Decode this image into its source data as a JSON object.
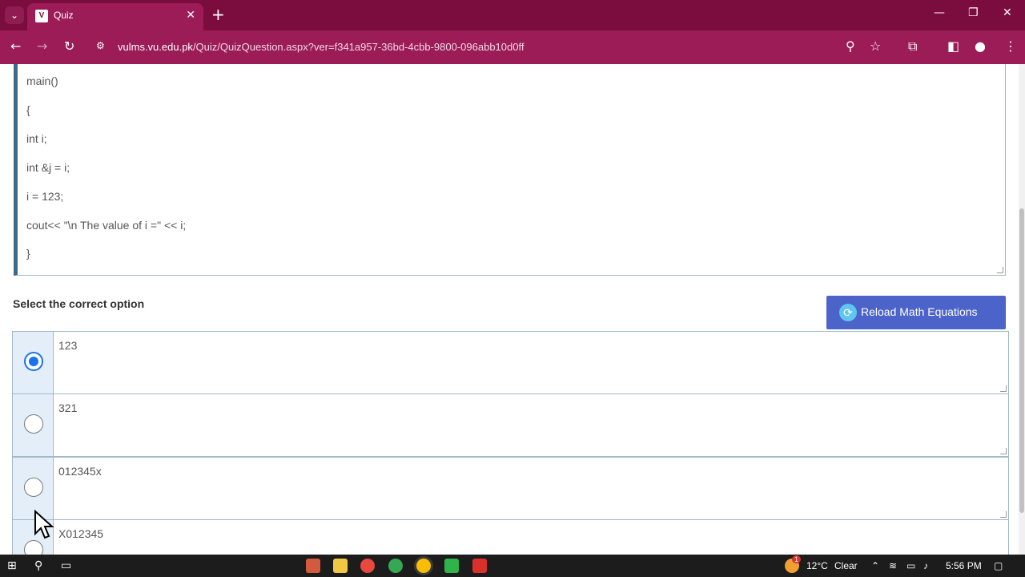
{
  "browser": {
    "tab_title": "Quiz",
    "favicon_text": "V",
    "url_host": "vulms.vu.edu.pk",
    "url_path": "/Quiz/QuizQuestion.aspx?ver=f341a957-36bd-4cbb-9800-096abb10d0ff"
  },
  "code": {
    "lines": [
      "main()",
      "{",
      "int i;",
      "int &j = i;",
      "i = 123;",
      "cout<< \"\\n The value of i =\" << i;",
      "}"
    ]
  },
  "question": {
    "select_label": "Select the correct option",
    "reload_button": "Reload Math Equations",
    "options": [
      {
        "text": "123",
        "selected": true
      },
      {
        "text": "321",
        "selected": false
      },
      {
        "text": "012345x",
        "selected": false
      },
      {
        "text": "X012345",
        "selected": false
      }
    ]
  },
  "taskbar": {
    "temperature": "12°C",
    "weather": "Clear",
    "time": "5:56 PM",
    "notification_badge": "1"
  },
  "colors": {
    "tab_strip": "#7a0d3e",
    "toolbar": "#9c1c58",
    "reload_button": "#4c63c9",
    "radio_selected": "#1a73e8",
    "radio_cell": "#e3eef8"
  }
}
